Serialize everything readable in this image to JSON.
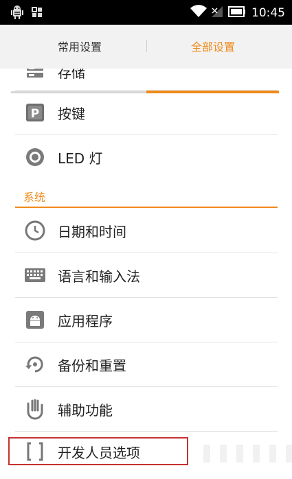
{
  "status_bar": {
    "time": "10:45",
    "icons_left": [
      "android-debug-icon",
      "app-grid-icon"
    ],
    "icons_right": [
      "wifi-icon",
      "signal-icon",
      "battery-icon"
    ]
  },
  "tabs": [
    {
      "label": "常用设置",
      "active": false
    },
    {
      "label": "全部设置",
      "active": true
    }
  ],
  "items_top": [
    {
      "label": "存储",
      "icon": "storage-icon"
    },
    {
      "label": "按键",
      "icon": "key-p-icon"
    },
    {
      "label": "LED 灯",
      "icon": "led-icon"
    }
  ],
  "section": {
    "title": "系统"
  },
  "items_system": [
    {
      "label": "日期和时间",
      "icon": "clock-icon"
    },
    {
      "label": "语言和输入法",
      "icon": "keyboard-icon"
    },
    {
      "label": "应用程序",
      "icon": "android-app-icon"
    },
    {
      "label": "备份和重置",
      "icon": "backup-reset-icon"
    },
    {
      "label": "辅助功能",
      "icon": "hand-icon"
    },
    {
      "label": "开发人员选项",
      "icon": "brackets-icon"
    }
  ],
  "colors": {
    "accent": "#f08a1a",
    "highlight_border": "#c6312f",
    "text": "#222222",
    "status_bar": "#000000"
  }
}
